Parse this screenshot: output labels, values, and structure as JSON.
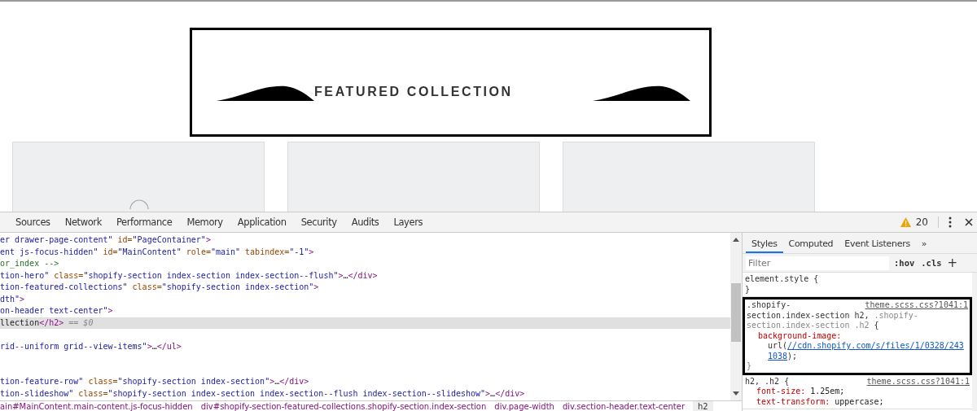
{
  "page": {
    "heading": "FEATURED COLLECTION",
    "cards": [
      {
        "kind": "spinner"
      },
      {
        "kind": "plain"
      },
      {
        "kind": "plain"
      }
    ]
  },
  "devtools": {
    "tabs": [
      {
        "label": "Sources",
        "selected": false
      },
      {
        "label": "Network",
        "selected": false
      },
      {
        "label": "Performance",
        "selected": false
      },
      {
        "label": "Memory",
        "selected": false
      },
      {
        "label": "Application",
        "selected": false
      },
      {
        "label": "Security",
        "selected": false
      },
      {
        "label": "Audits",
        "selected": false
      },
      {
        "label": "Layers",
        "selected": false
      }
    ],
    "warnings": "20",
    "elements": [
      {
        "kind": "code",
        "selected": false,
        "tokens": [
          {
            "kind": "value",
            "text": "er drawer-page-content\""
          },
          {
            "kind": "name",
            "text": " id="
          },
          {
            "kind": "value",
            "text": "\"PageContainer\""
          },
          {
            "kind": "tag",
            "text": ">"
          }
        ]
      },
      {
        "kind": "code",
        "selected": false,
        "tokens": [
          {
            "kind": "value",
            "text": "ent js-focus-hidden\""
          },
          {
            "kind": "name",
            "text": " id="
          },
          {
            "kind": "value",
            "text": "\"MainContent\""
          },
          {
            "kind": "name",
            "text": " role="
          },
          {
            "kind": "value",
            "text": "\"main\""
          },
          {
            "kind": "name",
            "text": " tabindex="
          },
          {
            "kind": "value",
            "text": "\"-1\""
          },
          {
            "kind": "tag",
            "text": ">"
          }
        ]
      },
      {
        "kind": "code",
        "selected": false,
        "tokens": [
          {
            "kind": "comment",
            "text": "or_index -->"
          }
        ]
      },
      {
        "kind": "code",
        "selected": false,
        "tokens": [
          {
            "kind": "value",
            "text": "tion-hero\""
          },
          {
            "kind": "name",
            "text": " class="
          },
          {
            "kind": "value",
            "text": "\"shopify-section index-section index-section--flush\""
          },
          {
            "kind": "tag",
            "text": ">"
          },
          {
            "kind": "text",
            "text": "…"
          },
          {
            "kind": "tag",
            "text": "</div>"
          }
        ]
      },
      {
        "kind": "code",
        "selected": false,
        "tokens": [
          {
            "kind": "value",
            "text": "tion-featured-collections\""
          },
          {
            "kind": "name",
            "text": " class="
          },
          {
            "kind": "value",
            "text": "\"shopify-section index-section\""
          },
          {
            "kind": "tag",
            "text": ">"
          }
        ]
      },
      {
        "kind": "code",
        "selected": false,
        "tokens": [
          {
            "kind": "value",
            "text": "dth\""
          },
          {
            "kind": "tag",
            "text": ">"
          }
        ]
      },
      {
        "kind": "code",
        "selected": false,
        "tokens": [
          {
            "kind": "value",
            "text": "on-header text-center\""
          },
          {
            "kind": "tag",
            "text": ">"
          }
        ]
      },
      {
        "kind": "code",
        "selected": true,
        "tokens": [
          {
            "kind": "text",
            "text": "llection"
          },
          {
            "kind": "tag",
            "text": "</h2>"
          },
          {
            "kind": "marker",
            "text": " == $0"
          }
        ]
      },
      {
        "kind": "blank"
      },
      {
        "kind": "code",
        "selected": false,
        "tokens": [
          {
            "kind": "value",
            "text": "rid--uniform grid--view-items\""
          },
          {
            "kind": "tag",
            "text": ">"
          },
          {
            "kind": "text",
            "text": "…"
          },
          {
            "kind": "tag",
            "text": "</ul>"
          }
        ]
      },
      {
        "kind": "blank"
      },
      {
        "kind": "blank"
      },
      {
        "kind": "code",
        "selected": false,
        "tokens": [
          {
            "kind": "value",
            "text": "tion-feature-row\""
          },
          {
            "kind": "name",
            "text": " class="
          },
          {
            "kind": "value",
            "text": "\"shopify-section index-section\""
          },
          {
            "kind": "tag",
            "text": ">"
          },
          {
            "kind": "text",
            "text": "…"
          },
          {
            "kind": "tag",
            "text": "</div>"
          }
        ]
      },
      {
        "kind": "code",
        "selected": false,
        "tokens": [
          {
            "kind": "value",
            "text": "tion-slideshow\""
          },
          {
            "kind": "name",
            "text": " class="
          },
          {
            "kind": "value",
            "text": "\"shopify-section index-section index-section--flush index-section--slideshow\""
          },
          {
            "kind": "tag",
            "text": ">"
          },
          {
            "kind": "text",
            "text": "…"
          },
          {
            "kind": "tag",
            "text": "</div>"
          }
        ]
      }
    ],
    "breadcrumbs": [
      {
        "label": "ain#MainContent.main-content.js-focus-hidden",
        "selected": false
      },
      {
        "label": "div#shopify-section-featured-collections.shopify-section.index-section",
        "selected": false
      },
      {
        "label": "div.page-width",
        "selected": false
      },
      {
        "label": "div.section-header.text-center",
        "selected": false
      },
      {
        "label": "h2",
        "selected": true
      }
    ],
    "side_tabs": [
      {
        "label": "Styles",
        "selected": true
      },
      {
        "label": "Computed",
        "selected": false
      },
      {
        "label": "Event Listeners",
        "selected": false
      }
    ],
    "more_tabs": "»",
    "filter": {
      "placeholder": "Filter"
    },
    "hov": ":hov",
    "cls": ".cls",
    "add": "+",
    "rules": [
      {
        "highlighted": false,
        "selector_lines": [
          [
            {
              "kind": "match",
              "text": "element.style {"
            }
          ]
        ],
        "close": "}"
      },
      {
        "highlighted": true,
        "source": "theme.scss.css?1041:1",
        "selector_lines": [
          [
            {
              "kind": "match",
              "text": ".shopify-"
            }
          ],
          [
            {
              "kind": "match",
              "text": "section.index-section h2,"
            },
            {
              "kind": "dim",
              "text": " .shopify-"
            }
          ],
          [
            {
              "kind": "dim",
              "text": "section.index-section .h2"
            },
            {
              "kind": "match",
              "text": " {"
            }
          ]
        ],
        "props": [
          {
            "kind": "url",
            "name": "background-image:",
            "value_prefix": "url(",
            "link": "//cdn.shopify.com/s/files/1/0328/243",
            "link_cont": "1038",
            "value_suffix": ");"
          }
        ],
        "close": "}"
      },
      {
        "highlighted": false,
        "source": "theme.scss.css?1041:1",
        "selector_lines": [
          [
            {
              "kind": "match",
              "text": "h2, .h2 {"
            }
          ]
        ],
        "props": [
          {
            "kind": "plain",
            "name": "font-size:",
            "value": "1.25em;"
          },
          {
            "kind": "plain",
            "name": "text-transform:",
            "value": "uppercase;"
          }
        ]
      }
    ]
  }
}
